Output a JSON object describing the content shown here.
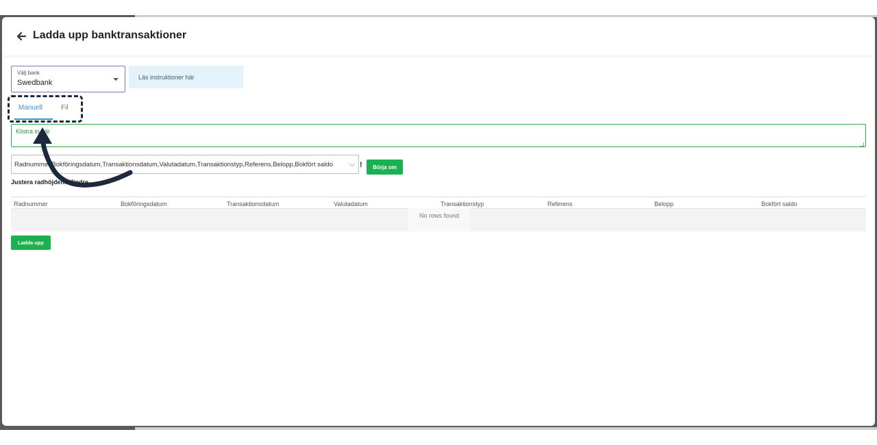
{
  "header": {
    "title": "Ladda upp banktransaktioner",
    "back_icon": "arrow-left-icon"
  },
  "bank_select": {
    "label": "Välj bank",
    "value": "Swedbank"
  },
  "instructions": {
    "label": "Läs instruktioner här"
  },
  "tabs": [
    {
      "label": "Manuell",
      "active": true
    },
    {
      "label": "Fil",
      "active": false
    }
  ],
  "paste_area": {
    "placeholder": "Klistra in här"
  },
  "columns_select": {
    "value": "Radnummer,Bokföringsdatum,Transaktionsdatum,Valutadatum,Transaktionstyp,Referens,Belopp,Bokfört saldo"
  },
  "warning_mark": "!",
  "restart_button": "Börja om",
  "row_height_label": "Justera radhöjden: Mindre",
  "table": {
    "columns": [
      "Radnummer",
      "Bokföringsdatum",
      "Transaktionsdatum",
      "Valutadatum",
      "Transaktionstyp",
      "Referens",
      "Belopp",
      "Bokfört saldo"
    ],
    "empty_text": "No rows found"
  },
  "upload_button": "Ladda upp",
  "colors": {
    "accent": "#3b8ed8",
    "green": "#1db052",
    "annotation": "#1c2a3d"
  }
}
